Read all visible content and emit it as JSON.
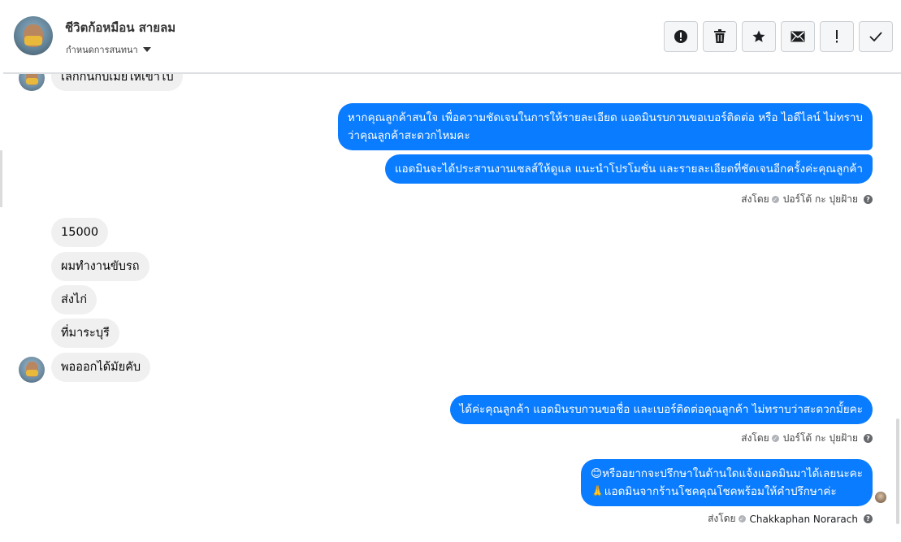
{
  "header": {
    "name": "ชีวิตก้อหมือน สายลม",
    "subtitle": "กำหนดการสนทนา"
  },
  "toolbar": {
    "icons": [
      "alert-circle-icon",
      "trash-icon",
      "star-icon",
      "envelope-icon",
      "exclamation-icon",
      "check-icon"
    ]
  },
  "messages": {
    "clipped_top": "เลิกกันกับเมียให้เขาไป",
    "admin_block1": {
      "line1": "หากคุณลูกค้าสนใจ เพื่อความชัดเจนในการให้รายละเอียด แอดมินรบกวนขอเบอร์ติดต่อ หรือ ไอดีไลน์ ไม่ทราบ",
      "line2": "ว่าคุณลูกค้าสะดวกไหมคะ",
      "line3": "แอดมินจะได้ประสานงานเซลส์ให้ดูแล แนะนำโปรโมชั่น และรายละเอียดที่ชัดเจนอีกครั้งค่ะคุณลูกค้า"
    },
    "sent_by_1": {
      "prefix": "ส่งโดย",
      "agent": "ปอร์โต้ กะ ปุยฝ้าย"
    },
    "customer": [
      "15000",
      "ผมทำงานขับรถ",
      "ส่งไก่",
      "ที่มาระบุรี",
      "พอออกได้มัยคับ"
    ],
    "admin_block2": "ได้ค่ะคุณลูกค้า แอดมินรบกวนขอชื่อ และเบอร์ติดต่อคุณลูกค้า ไม่ทราบว่าสะดวกมั้ยคะ",
    "sent_by_2": {
      "prefix": "ส่งโดย",
      "agent": "ปอร์โต้ กะ ปุยฝ้าย"
    },
    "admin_block3": {
      "line1": "😊หรืออยากจะปรึกษาในด้านใดแจ้งแอดมินมาได้เลยนะคะ",
      "line2": "🙏แอดมินจากร้านโชคคุณโชคพร้อมให้คำปรึกษาค่ะ"
    },
    "sent_by_3": {
      "prefix": "ส่งโดย",
      "agent": "Chakkaphan Norarach"
    }
  },
  "colors": {
    "bubble_admin": "#0a7cff",
    "bubble_customer": "#f0f0f0"
  }
}
